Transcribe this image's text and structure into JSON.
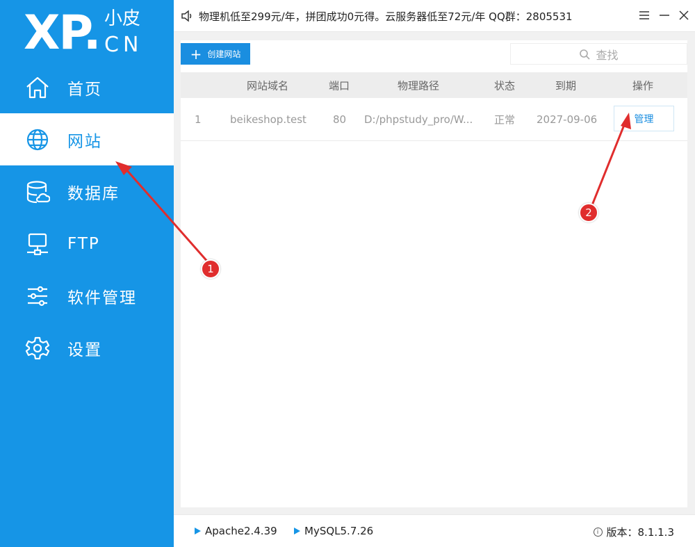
{
  "logo": {
    "main": "XP.",
    "sub": "小皮",
    "domain": "CN"
  },
  "sidebar": {
    "items": [
      {
        "label": "首页",
        "icon": "home-icon"
      },
      {
        "label": "网站",
        "icon": "globe-icon",
        "active": true
      },
      {
        "label": "数据库",
        "icon": "database-icon"
      },
      {
        "label": "FTP",
        "icon": "ftp-icon"
      },
      {
        "label": "软件管理",
        "icon": "sliders-icon"
      },
      {
        "label": "设置",
        "icon": "gear-icon"
      }
    ]
  },
  "topbar": {
    "announcement": "物理机低至299元/年，拼团成功0元得。云服务器低至72元/年  QQ群：2805531",
    "controls": [
      "menu-icon",
      "minimize-icon",
      "close-icon"
    ]
  },
  "toolbar": {
    "create_label": "创建网站",
    "search_placeholder": "查找"
  },
  "table": {
    "headers": [
      "网站域名",
      "端口",
      "物理路径",
      "状态",
      "到期",
      "操作"
    ],
    "rows": [
      {
        "index": "1",
        "domain": "beikeshop.test",
        "port": "80",
        "path": "D:/phpstudy_pro/W...",
        "status": "正常",
        "expiry": "2027-09-06",
        "action": "管理"
      }
    ]
  },
  "footer": {
    "services": [
      "Apache2.4.39",
      "MySQL5.7.26"
    ],
    "version_label": "版本：",
    "version": "8.1.1.3"
  },
  "annotations": {
    "marker1": "1",
    "marker2": "2"
  },
  "colors": {
    "primary": "#1695e6",
    "annotation": "#e02d2d"
  }
}
